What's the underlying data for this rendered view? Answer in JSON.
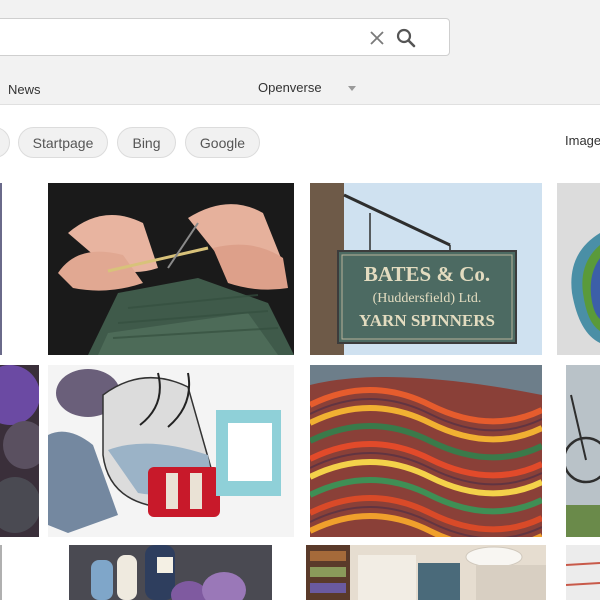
{
  "search": {
    "query": ""
  },
  "nav": {
    "news": "News",
    "openverse": "Openverse"
  },
  "engines": [
    "Startpage",
    "Bing",
    "Google"
  ],
  "type_label": "Image",
  "sign": {
    "line1": "BATES & Co.",
    "line2": "(Huddersfield) Ltd.",
    "line3": "YARN SPINNERS"
  },
  "colors": {
    "topbar": "#f2f2f2",
    "pill": "#f1f1f1",
    "text": "#333333"
  },
  "icons": [
    "close-icon",
    "search-icon",
    "chevron-down-icon"
  ]
}
